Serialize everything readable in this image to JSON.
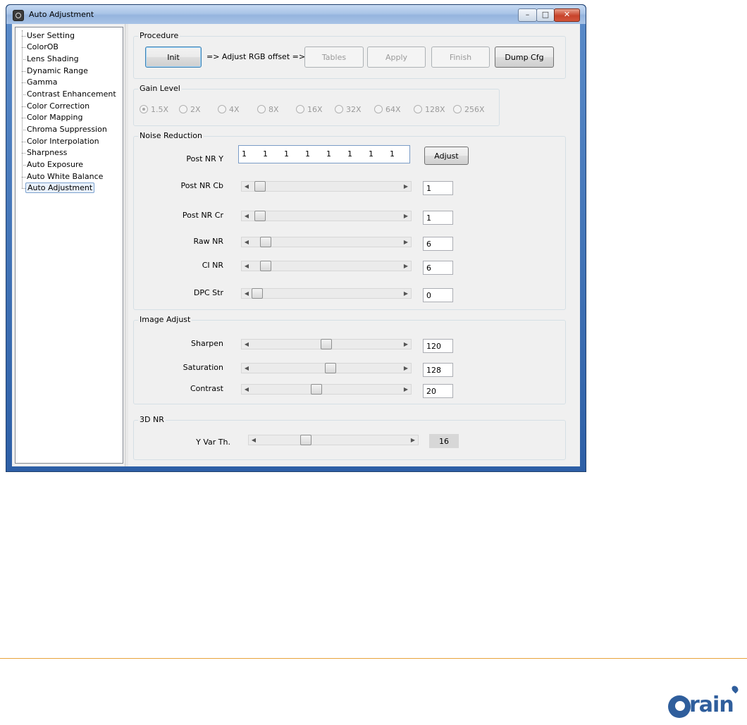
{
  "window": {
    "title": "Auto Adjustment"
  },
  "tree": {
    "items": [
      {
        "label": "User Setting"
      },
      {
        "label": "ColorOB"
      },
      {
        "label": "Lens Shading"
      },
      {
        "label": "Dynamic Range"
      },
      {
        "label": "Gamma"
      },
      {
        "label": "Contrast Enhancement"
      },
      {
        "label": "Color Correction"
      },
      {
        "label": "Color Mapping"
      },
      {
        "label": "Chroma Suppression"
      },
      {
        "label": "Color Interpolation"
      },
      {
        "label": "Sharpness"
      },
      {
        "label": "Auto Exposure"
      },
      {
        "label": "Auto White Balance"
      },
      {
        "label": "Auto Adjustment",
        "selected": true
      }
    ]
  },
  "procedure": {
    "title": "Procedure",
    "init_label": "Init",
    "arrow_text": "=> Adjust RGB offset =>",
    "tables_label": "Tables",
    "apply_label": "Apply",
    "finish_label": "Finish",
    "dump_label": "Dump Cfg"
  },
  "gain_level": {
    "title": "Gain Level",
    "options": [
      "1.5X",
      "2X",
      "4X",
      "8X",
      "16X",
      "32X",
      "64X",
      "128X",
      "256X"
    ],
    "selected": "1.5X"
  },
  "noise_reduction": {
    "title": "Noise Reduction",
    "post_nr_y": {
      "label": "Post NR Y",
      "values": [
        "1",
        "1",
        "1",
        "1",
        "1",
        "1",
        "1",
        "1"
      ],
      "adjust_label": "Adjust"
    },
    "sliders": [
      {
        "label": "Post NR Cb",
        "value": "1",
        "level": 0.02
      },
      {
        "label": "Post NR Cr",
        "value": "1",
        "level": 0.02
      },
      {
        "label": "Raw NR",
        "value": "6",
        "level": 0.06
      },
      {
        "label": "CI NR",
        "value": "6",
        "level": 0.06
      },
      {
        "label": "DPC Str",
        "value": "0",
        "level": 0.0
      }
    ]
  },
  "image_adjust": {
    "title": "Image Adjust",
    "sliders": [
      {
        "label": "Sharpen",
        "value": "120",
        "level": 0.5
      },
      {
        "label": "Saturation",
        "value": "128",
        "level": 0.53
      },
      {
        "label": "Contrast",
        "value": "20",
        "level": 0.43
      }
    ]
  },
  "nr3d": {
    "title": "3D NR",
    "slider": {
      "label": "Y Var Th.",
      "value": "16",
      "level": 0.3
    }
  }
}
